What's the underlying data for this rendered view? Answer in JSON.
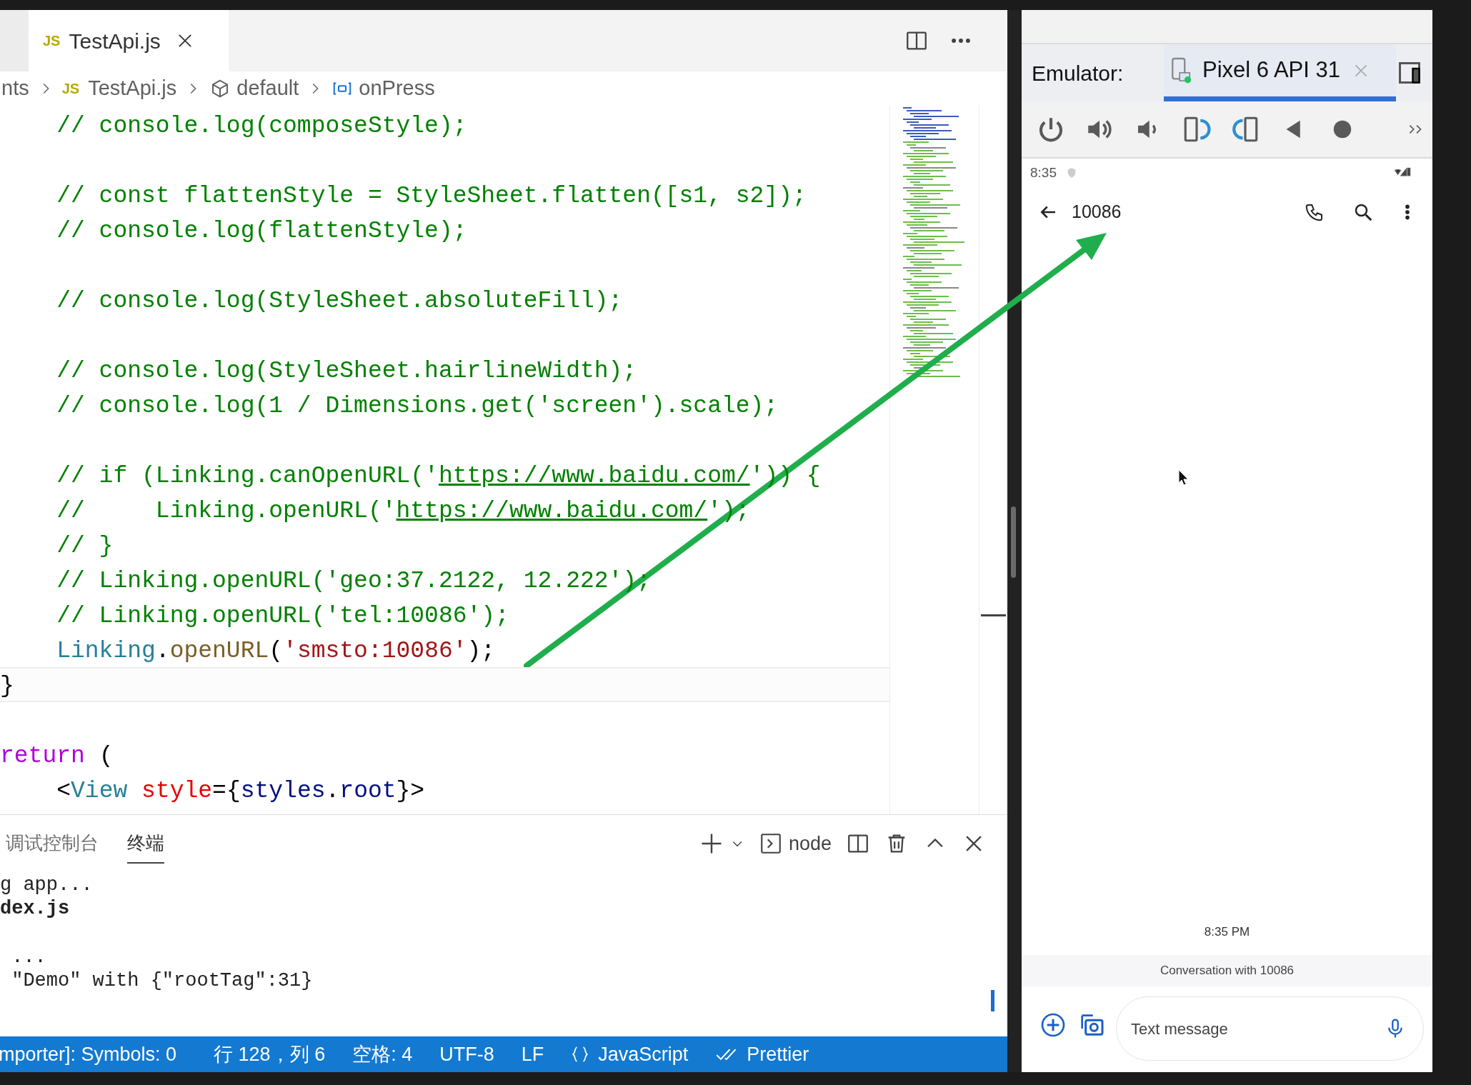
{
  "editor": {
    "tab": {
      "badge": "JS",
      "title": "TestApi.js",
      "selected": true
    },
    "breadcrumb": [
      {
        "kind": "folder",
        "text": "nts"
      },
      {
        "kind": "file",
        "badge": "JS",
        "text": "TestApi.js"
      },
      {
        "kind": "module",
        "text": "default"
      },
      {
        "kind": "variable",
        "text": "onPress"
      }
    ],
    "code_lines": [
      {
        "current": false,
        "tokens": [
          {
            "kind": "comment",
            "text": "    // console.log(composeStyle);"
          }
        ]
      },
      {
        "current": false
      },
      {
        "current": false,
        "tokens": [
          {
            "kind": "comment",
            "text": "    // const flattenStyle = StyleSheet.flatten([s1, s2]);"
          }
        ]
      },
      {
        "current": false,
        "tokens": [
          {
            "kind": "comment",
            "text": "    // console.log(flattenStyle);"
          }
        ]
      },
      {
        "current": false
      },
      {
        "current": false,
        "tokens": [
          {
            "kind": "comment",
            "text": "    // console.log(StyleSheet.absoluteFill);"
          }
        ]
      },
      {
        "current": false
      },
      {
        "current": false,
        "tokens": [
          {
            "kind": "comment",
            "text": "    // console.log(StyleSheet.hairlineWidth);"
          }
        ]
      },
      {
        "current": false,
        "tokens": [
          {
            "kind": "comment",
            "text": "    // console.log(1 / Dimensions.get('screen').scale);"
          }
        ]
      },
      {
        "current": false
      },
      {
        "current": false,
        "tokens": [
          {
            "kind": "comment",
            "text": "    // if (Linking.canOpenURL('"
          },
          {
            "kind": "link",
            "text": "https://www.baidu.com/"
          },
          {
            "kind": "comment",
            "text": "')) {"
          }
        ]
      },
      {
        "current": false,
        "tokens": [
          {
            "kind": "comment",
            "text": "    //     Linking.openURL('"
          },
          {
            "kind": "link",
            "text": "https://www.baidu.com/"
          },
          {
            "kind": "comment",
            "text": "');"
          }
        ]
      },
      {
        "current": false,
        "tokens": [
          {
            "kind": "comment",
            "text": "    // }"
          }
        ]
      },
      {
        "current": false,
        "tokens": [
          {
            "kind": "comment",
            "text": "    // Linking.openURL('geo:37.2122, 12.222');"
          }
        ]
      },
      {
        "current": false,
        "tokens": [
          {
            "kind": "comment",
            "text": "    // Linking.openURL('tel:10086');"
          }
        ]
      },
      {
        "current": false,
        "tokens": [
          {
            "kind": "type",
            "text": "    Linking"
          },
          {
            "kind": "punct",
            "text": "."
          },
          {
            "kind": "function",
            "text": "openURL"
          },
          {
            "kind": "punct",
            "text": "("
          },
          {
            "kind": "string",
            "text": "'smsto:10086'"
          },
          {
            "kind": "punct",
            "text": ");"
          }
        ]
      },
      {
        "current": true,
        "tokens": [
          {
            "kind": "punct",
            "text": "}"
          }
        ]
      },
      {
        "current": false
      },
      {
        "current": false,
        "tokens": [
          {
            "kind": "keyword",
            "text": "return"
          },
          {
            "kind": "punct",
            "text": " ("
          }
        ]
      },
      {
        "current": false,
        "tokens": [
          {
            "kind": "punct",
            "text": "    <"
          },
          {
            "kind": "type",
            "text": "View"
          },
          {
            "kind": "attr",
            "text": " style"
          },
          {
            "kind": "punct",
            "text": "={"
          },
          {
            "kind": "variable",
            "text": "styles"
          },
          {
            "kind": "punct",
            "text": "."
          },
          {
            "kind": "variable",
            "text": "root"
          },
          {
            "kind": "punct",
            "text": "}>"
          }
        ]
      }
    ]
  },
  "panel": {
    "tabs": [
      {
        "label": "调试控制台",
        "selected": false
      },
      {
        "label": "终端",
        "selected": true
      }
    ],
    "shell": "node",
    "output_blocks": [
      [
        {
          "text": "g app...",
          "bold": false
        },
        {
          "text": "dex.js",
          "bold": true
        }
      ],
      [
        {
          "text": " ...",
          "bold": false
        },
        {
          "text": " \"Demo\" with {\"rootTag\":31}",
          "bold": false
        }
      ]
    ]
  },
  "status_bar": [
    {
      "kind": "text",
      "text": "mporter]: Symbols: 0"
    },
    {
      "kind": "text",
      "text": "行 128，列 6"
    },
    {
      "kind": "text",
      "text": "空格: 4"
    },
    {
      "kind": "text",
      "text": "UTF-8"
    },
    {
      "kind": "text",
      "text": "LF"
    },
    {
      "kind": "language",
      "text": "JavaScript"
    },
    {
      "kind": "formatter",
      "text": "Prettier"
    }
  ],
  "emulator": {
    "label": "Emulator:",
    "device_tab": {
      "title": "Pixel 6 API 31",
      "selected": true
    },
    "phone": {
      "clock": "8:35",
      "contact": "10086",
      "timestamp": "8:35 PM",
      "conversation_note": "Conversation with 10086",
      "compose": {
        "placeholder": "Text message"
      }
    }
  }
}
